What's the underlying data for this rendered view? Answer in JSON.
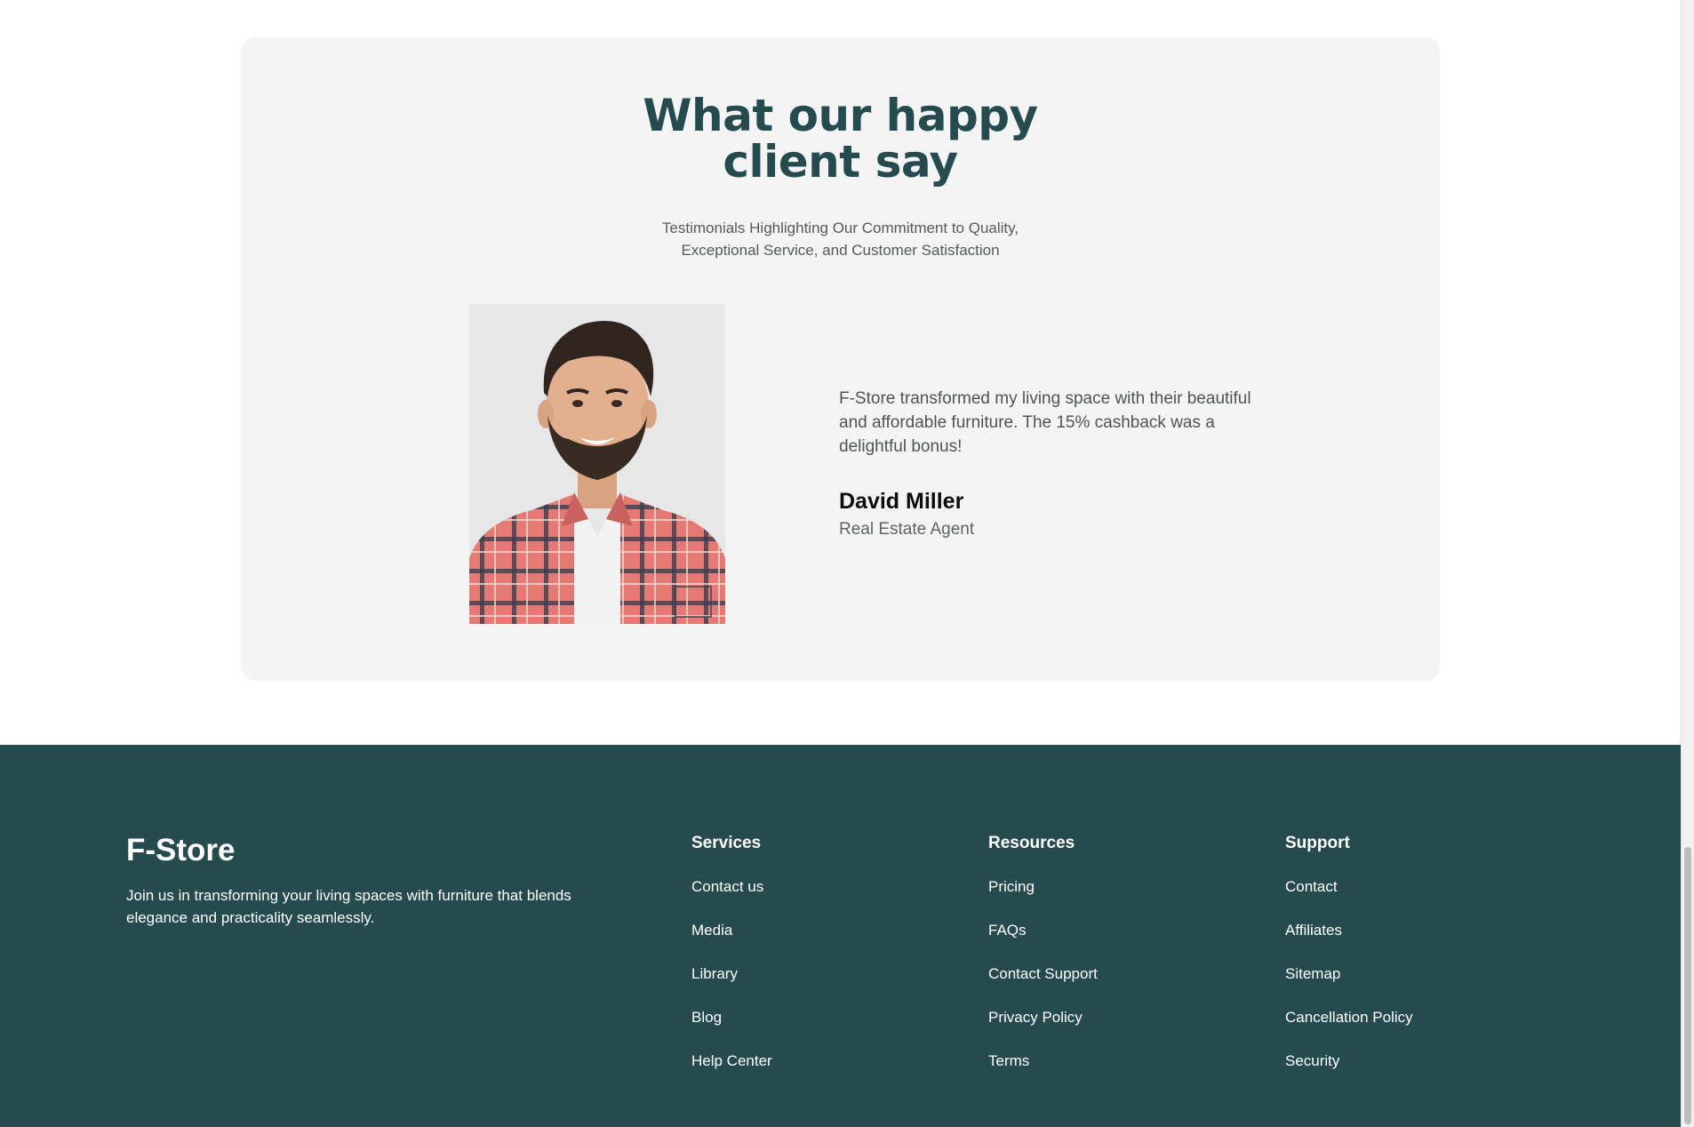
{
  "testimonials": {
    "heading_line1": "What our happy",
    "heading_line2": "client say",
    "subtitle_line1": "Testimonials Highlighting Our Commitment to Quality,",
    "subtitle_line2": "Exceptional Service, and Customer Satisfaction",
    "quote_line1": "F-Store transformed my living space with their beautiful",
    "quote_line2": "and affordable furniture. The 15% cashback was a",
    "quote_line3": "delightful bonus!",
    "author_name": "David Miller",
    "author_role": "Real Estate Agent"
  },
  "footer": {
    "brand": "F-Store",
    "desc_line1": "Join us in transforming your living spaces with furniture that blends",
    "desc_line2": "elegance and practicality seamlessly.",
    "columns": [
      {
        "title": "Services",
        "links": [
          "Contact us",
          "Media",
          "Library",
          "Blog",
          "Help Center"
        ]
      },
      {
        "title": "Resources",
        "links": [
          "Pricing",
          "FAQs",
          "Contact Support",
          "Privacy Policy",
          "Terms"
        ]
      },
      {
        "title": "Support",
        "links": [
          "Contact",
          "Affiliates",
          "Sitemap",
          "Cancellation Policy",
          "Security"
        ]
      }
    ]
  },
  "colors": {
    "brand_dark": "#254b4e",
    "card_bg": "#f3f4f3",
    "heading": "#254b4e"
  }
}
